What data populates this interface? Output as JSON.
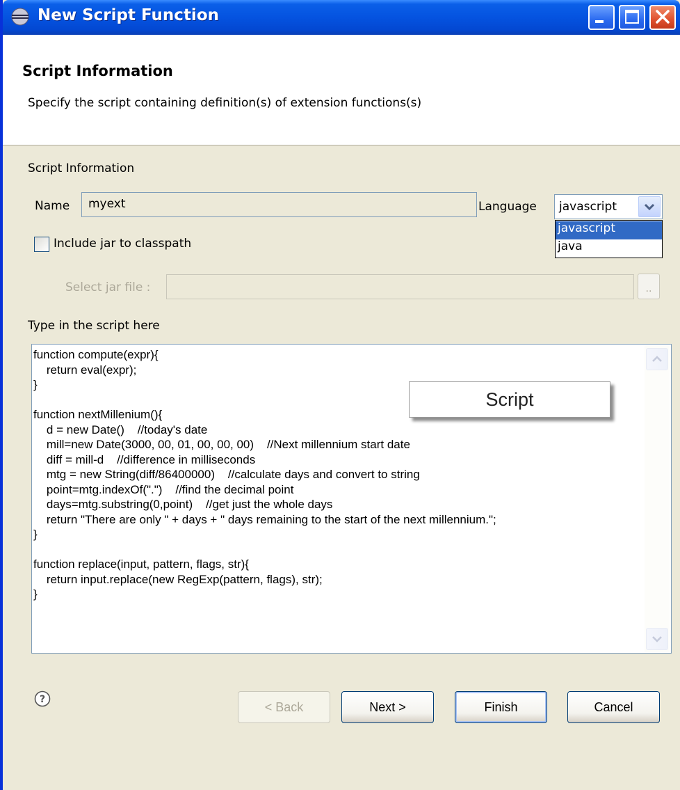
{
  "window": {
    "title": "New Script Function",
    "controls": {
      "minimize": "minimize",
      "maximize": "maximize",
      "close": "close"
    }
  },
  "header": {
    "title": "Script Information",
    "description": "Specify the script containing definition(s) of extension functions(s)"
  },
  "form": {
    "group_label": "Script Information",
    "name_label": "Name",
    "name_value": "myext",
    "language_label": "Language",
    "language_value": "javascript",
    "language_options": [
      "javascript",
      "java"
    ],
    "include_jar_label": "Include jar to classpath",
    "include_jar_checked": false,
    "select_jar_label": "Select jar file :",
    "select_jar_value": "",
    "browse_label": "..",
    "script_label": "Type in the script here"
  },
  "script": {
    "code": "function compute(expr){\n    return eval(expr);\n}\n\nfunction nextMillenium(){\n    d = new Date()    //today's date\n    mill=new Date(3000, 00, 01, 00, 00, 00)    //Next millennium start date\n    diff = mill-d    //difference in milliseconds\n    mtg = new String(diff/86400000)    //calculate days and convert to string\n    point=mtg.indexOf(\".\")    //find the decimal point\n    days=mtg.substring(0,point)    //get just the whole days\n    return \"There are only \" + days + \" days remaining to the start of the next millennium.\";\n}\n\nfunction replace(input, pattern, flags, str){\n    return input.replace(new RegExp(pattern, flags), str);\n}"
  },
  "callout": {
    "label": "Script"
  },
  "buttons": {
    "back": "< Back",
    "next": "Next >",
    "finish": "Finish",
    "cancel": "Cancel"
  },
  "colors": {
    "titlebar": "#0553E0",
    "dialog_bg": "#ECE9D8",
    "selection": "#316AC5"
  }
}
